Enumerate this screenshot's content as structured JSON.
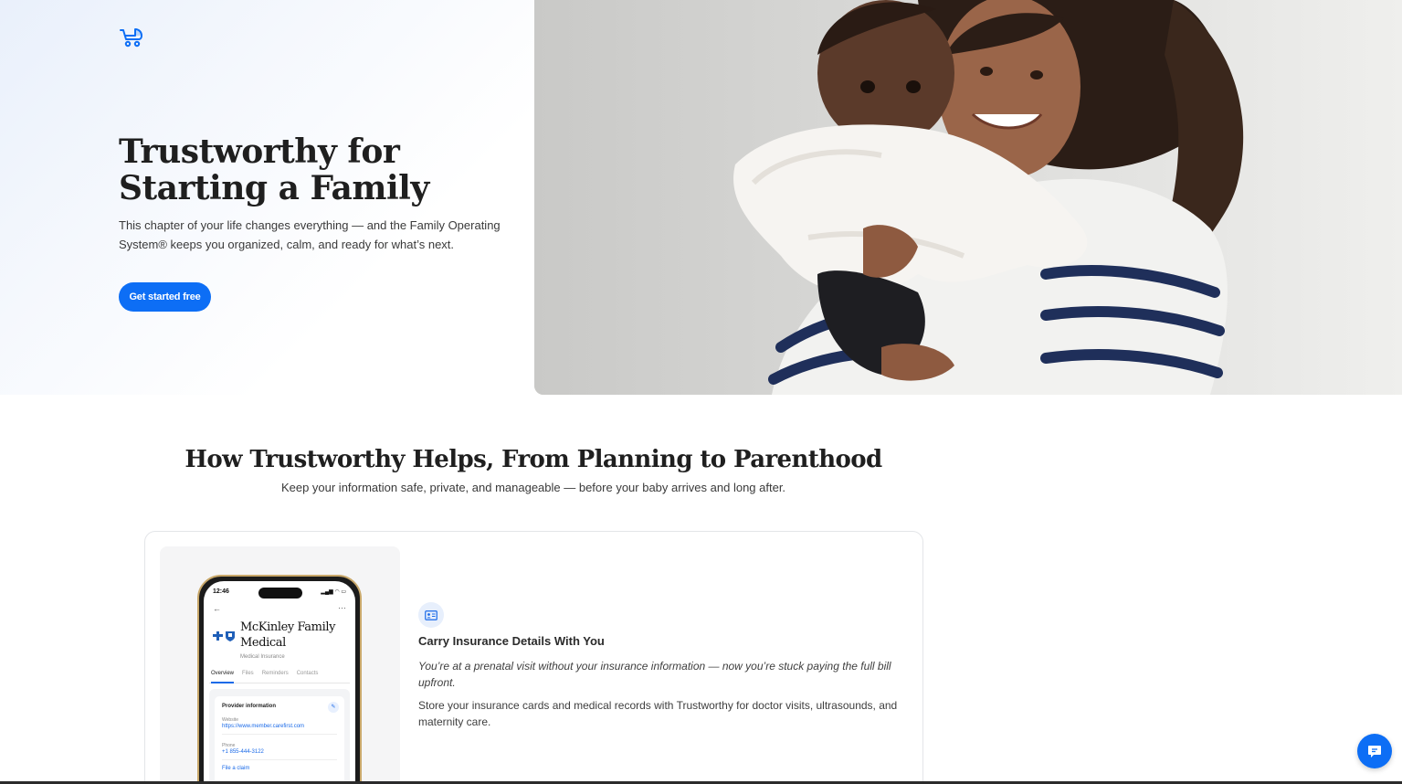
{
  "hero": {
    "title": "Trustworthy for Starting a Family",
    "subtitle": "This chapter of your life changes everything — and the Family Operating System® keeps you organized, calm, and ready for what’s next.",
    "cta_label": "Get started free",
    "logo_icon": "baby-stroller-icon",
    "photo": "mother-holding-baby-photo"
  },
  "section": {
    "title": "How Trustworthy Helps, From Planning to Parenthood",
    "subtitle": "Keep your information safe, private, and manageable — before your baby arrives and long after."
  },
  "feature": {
    "icon": "id-card-icon",
    "title": "Carry Insurance Details With You",
    "problem": "You’re at a prenatal visit without your insurance information — now you’re stuck paying the full bill upfront.",
    "solution": "Store your insurance cards and medical records with Trustworthy for doctor visits, ultrasounds, and maternity care."
  },
  "phone": {
    "time": "12:46",
    "name": "McKinley Family Medical",
    "type": "Medical Insurance",
    "tabs": [
      "Overview",
      "Files",
      "Reminders",
      "Contacts"
    ],
    "panel_title": "Provider information",
    "fields": [
      {
        "label": "Website",
        "value": "https://www.member.carefirst.com"
      },
      {
        "label": "Phone",
        "value": "+1 855-444-3122"
      }
    ],
    "link": "File a claim"
  },
  "colors": {
    "accent": "#0d6ef5",
    "text": "#2a2a2a"
  },
  "chat": {
    "icon": "chat-bubble-icon"
  }
}
